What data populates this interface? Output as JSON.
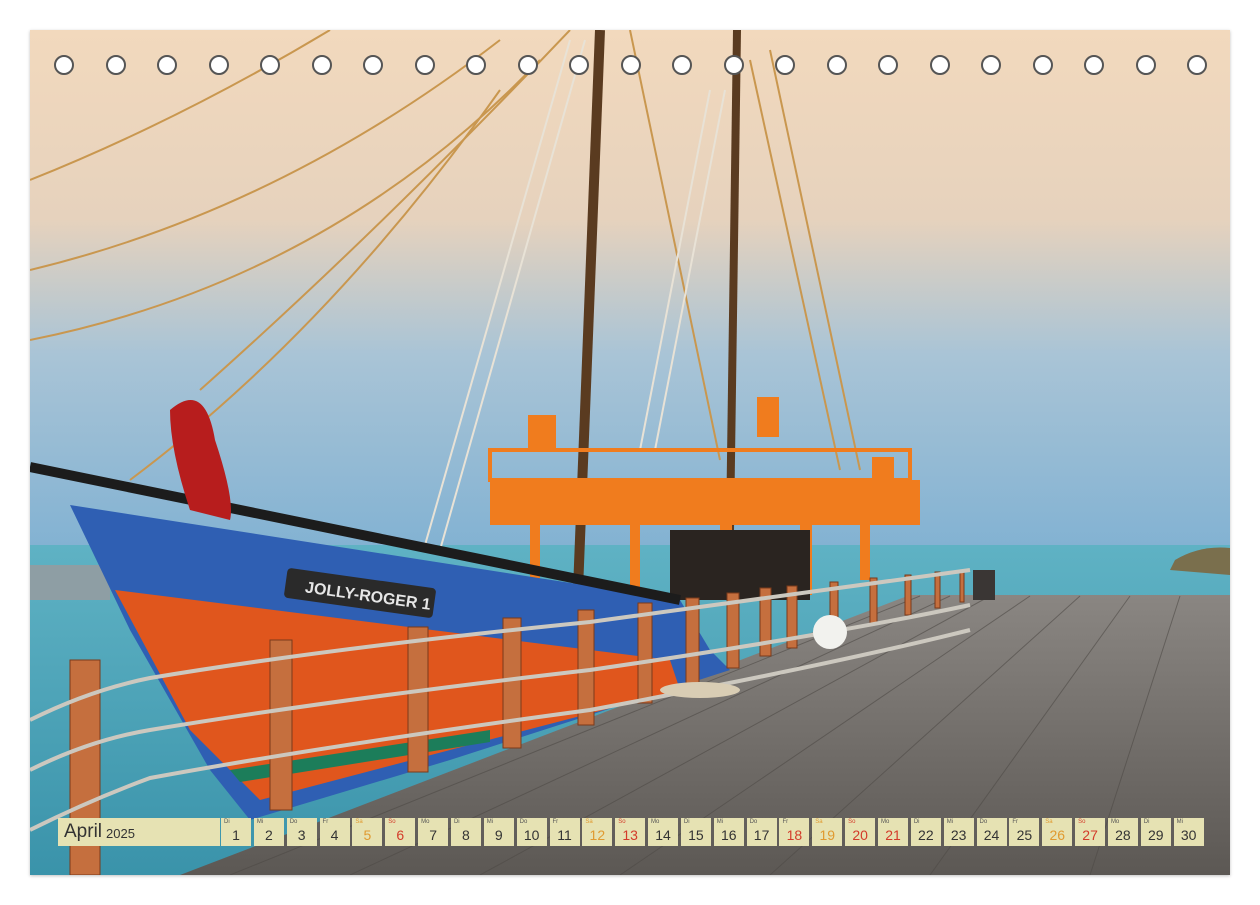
{
  "photo": {
    "hull_name": "JOLLY-ROGER 1",
    "colors": {
      "hull_blue": "#2f5fb3",
      "hull_orange": "#e0561d",
      "deck_orange": "#f07c1e",
      "sea": "#4fa7b9",
      "dock": "#6e6a66"
    }
  },
  "binding_holes": 23,
  "calendar": {
    "month": "April",
    "year": "2025",
    "days": [
      {
        "dow": "Di",
        "num": "1",
        "type": "weekday"
      },
      {
        "dow": "Mi",
        "num": "2",
        "type": "weekday"
      },
      {
        "dow": "Do",
        "num": "3",
        "type": "weekday"
      },
      {
        "dow": "Fr",
        "num": "4",
        "type": "weekday"
      },
      {
        "dow": "Sa",
        "num": "5",
        "type": "sat"
      },
      {
        "dow": "So",
        "num": "6",
        "type": "sun"
      },
      {
        "dow": "Mo",
        "num": "7",
        "type": "weekday"
      },
      {
        "dow": "Di",
        "num": "8",
        "type": "weekday"
      },
      {
        "dow": "Mi",
        "num": "9",
        "type": "weekday"
      },
      {
        "dow": "Do",
        "num": "10",
        "type": "weekday"
      },
      {
        "dow": "Fr",
        "num": "11",
        "type": "weekday"
      },
      {
        "dow": "Sa",
        "num": "12",
        "type": "sat"
      },
      {
        "dow": "So",
        "num": "13",
        "type": "sun"
      },
      {
        "dow": "Mo",
        "num": "14",
        "type": "weekday"
      },
      {
        "dow": "Di",
        "num": "15",
        "type": "weekday"
      },
      {
        "dow": "Mi",
        "num": "16",
        "type": "weekday"
      },
      {
        "dow": "Do",
        "num": "17",
        "type": "weekday"
      },
      {
        "dow": "Fr",
        "num": "18",
        "type": "holiday"
      },
      {
        "dow": "Sa",
        "num": "19",
        "type": "sat"
      },
      {
        "dow": "So",
        "num": "20",
        "type": "sun"
      },
      {
        "dow": "Mo",
        "num": "21",
        "type": "holiday"
      },
      {
        "dow": "Di",
        "num": "22",
        "type": "weekday"
      },
      {
        "dow": "Mi",
        "num": "23",
        "type": "weekday"
      },
      {
        "dow": "Do",
        "num": "24",
        "type": "weekday"
      },
      {
        "dow": "Fr",
        "num": "25",
        "type": "weekday"
      },
      {
        "dow": "Sa",
        "num": "26",
        "type": "sat"
      },
      {
        "dow": "So",
        "num": "27",
        "type": "sun"
      },
      {
        "dow": "Mo",
        "num": "28",
        "type": "weekday"
      },
      {
        "dow": "Di",
        "num": "29",
        "type": "weekday"
      },
      {
        "dow": "Mi",
        "num": "30",
        "type": "weekday"
      }
    ]
  }
}
